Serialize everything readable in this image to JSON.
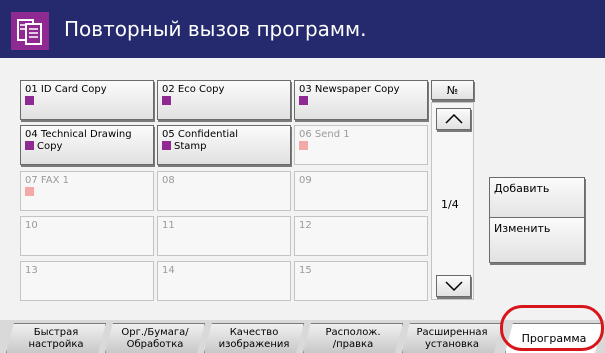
{
  "header": {
    "title": "Повторный вызов программ.",
    "icon": "program-recall-icon",
    "background": "#252a6e",
    "icon_color": "#8e2a92"
  },
  "slots": [
    {
      "line1": "01  ID Card Copy",
      "line2": "",
      "active": true
    },
    {
      "line1": "02  Eco Copy",
      "line2": "",
      "active": true
    },
    {
      "line1": "03  Newspaper Copy",
      "line2": "",
      "active": true
    },
    {
      "line1": "04  Technical Drawing",
      "line2": "Copy",
      "active": true
    },
    {
      "line1": "05  Confidential",
      "line2": "Stamp",
      "active": true
    },
    {
      "line1": "06  Send 1",
      "line2": "",
      "active": false
    },
    {
      "line1": "07  FAX 1",
      "line2": "",
      "active": false
    },
    {
      "line1": "08",
      "line2": "",
      "active": false
    },
    {
      "line1": "09",
      "line2": "",
      "active": false
    },
    {
      "line1": "10",
      "line2": "",
      "active": false
    },
    {
      "line1": "11",
      "line2": "",
      "active": false
    },
    {
      "line1": "12",
      "line2": "",
      "active": false
    },
    {
      "line1": "13",
      "line2": "",
      "active": false
    },
    {
      "line1": "14",
      "line2": "",
      "active": false
    },
    {
      "line1": "15",
      "line2": "",
      "active": false
    }
  ],
  "nav": {
    "number_label": "№",
    "page": "1/4",
    "up_icon": "chevron-up-icon",
    "down_icon": "chevron-down-icon"
  },
  "side_buttons": {
    "add": "Добавить",
    "edit": "Изменить"
  },
  "tabs": [
    {
      "line1": "Быстрая",
      "line2": "настройка"
    },
    {
      "line1": "Орг./Бумага/",
      "line2": "Обработка"
    },
    {
      "line1": "Качество",
      "line2": "изображения"
    },
    {
      "line1": "Располож.",
      "line2": "/правка"
    },
    {
      "line1": "Расширенная",
      "line2": "установка"
    },
    {
      "line1": "Программа",
      "line2": "",
      "selected": true
    }
  ],
  "highlight_color": "#d7161b"
}
